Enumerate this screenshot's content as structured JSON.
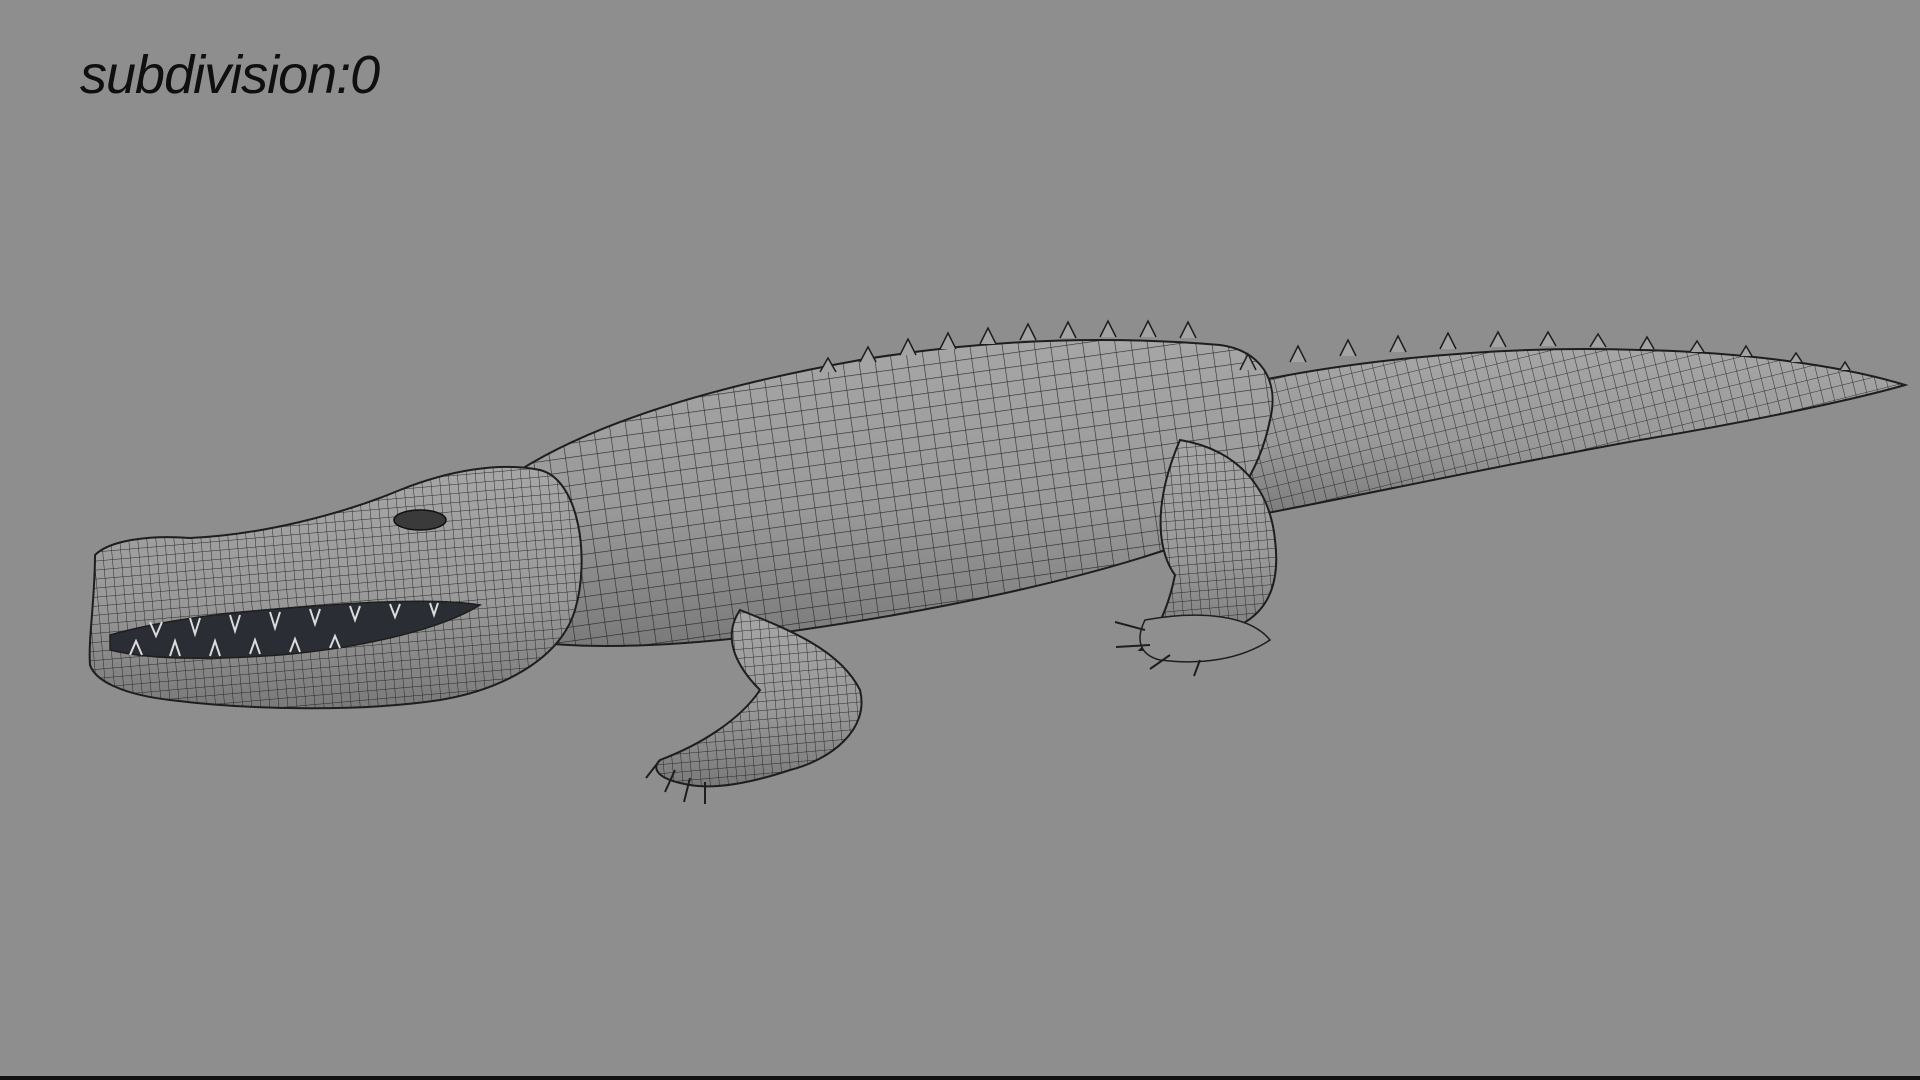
{
  "viewport": {
    "label": "subdivision:0",
    "background_color": "#8e8e8e",
    "subject": "crocodile-wireframe-mesh"
  },
  "colors": {
    "mesh_fill": "#9b9b9b",
    "mesh_shade": "#6f6f6f",
    "wire": "#1e1e1e",
    "mouth": "#2a2d33"
  }
}
